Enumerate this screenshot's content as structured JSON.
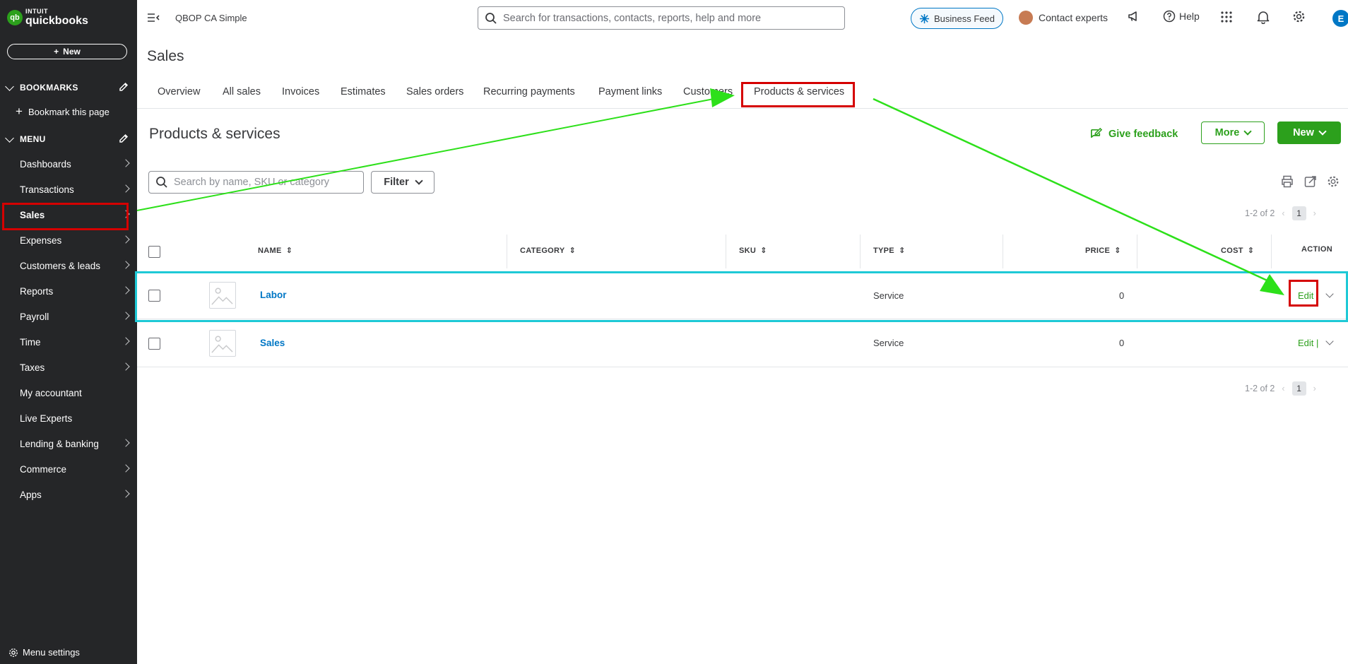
{
  "brand": {
    "line1": "INTUIT",
    "line2": "quickbooks",
    "mark": "qb"
  },
  "sidebar": {
    "new_label": "New",
    "bookmarks_label": "BOOKMARKS",
    "bookmark_page": "Bookmark this page",
    "menu_label": "MENU",
    "items": [
      {
        "label": "Dashboards",
        "arrow": true
      },
      {
        "label": "Transactions",
        "arrow": true
      },
      {
        "label": "Sales",
        "arrow": true,
        "active": true
      },
      {
        "label": "Expenses",
        "arrow": true
      },
      {
        "label": "Customers & leads",
        "arrow": true
      },
      {
        "label": "Reports",
        "arrow": true
      },
      {
        "label": "Payroll",
        "arrow": true
      },
      {
        "label": "Time",
        "arrow": true
      },
      {
        "label": "Taxes",
        "arrow": true
      },
      {
        "label": "My accountant",
        "arrow": false
      },
      {
        "label": "Live Experts",
        "arrow": false
      },
      {
        "label": "Lending & banking",
        "arrow": true
      },
      {
        "label": "Commerce",
        "arrow": true
      },
      {
        "label": "Apps",
        "arrow": true
      }
    ],
    "menu_settings": "Menu settings"
  },
  "topbar": {
    "company": "QBOP CA Simple",
    "search_placeholder": "Search for transactions, contacts, reports, help and more",
    "business_feed": "Business Feed",
    "contact_experts": "Contact experts",
    "help": "Help",
    "user_initial": "E"
  },
  "page": {
    "title": "Sales",
    "tabs": [
      "Overview",
      "All sales",
      "Invoices",
      "Estimates",
      "Sales orders",
      "Recurring payments",
      "Payment links",
      "Customers",
      "Products & services"
    ],
    "active_tab": "Products & services"
  },
  "products": {
    "title": "Products & services",
    "give_feedback": "Give feedback",
    "more": "More",
    "new": "New",
    "search_placeholder": "Search by name, SKU or category",
    "filter": "Filter",
    "pagination_top": "1-2 of 2",
    "pagination_bottom": "1-2 of 2",
    "page_number": "1",
    "columns": {
      "name": "NAME",
      "category": "CATEGORY",
      "sku": "SKU",
      "type": "TYPE",
      "price": "PRICE",
      "cost": "COST",
      "action": "ACTION"
    },
    "rows": [
      {
        "name": "Labor",
        "category": "",
        "sku": "",
        "type": "Service",
        "price": "0",
        "cost": "",
        "action": "Edit"
      },
      {
        "name": "Sales",
        "category": "",
        "sku": "",
        "type": "Service",
        "price": "0",
        "cost": "",
        "action": "Edit |"
      }
    ]
  },
  "colors": {
    "sidebar_bg": "#252628",
    "accent_green": "#2ca01c",
    "link_blue": "#0077c5",
    "annotation_red": "#d50000",
    "annotation_green": "#2de01a",
    "highlight_cyan": "#1ec9d6"
  }
}
